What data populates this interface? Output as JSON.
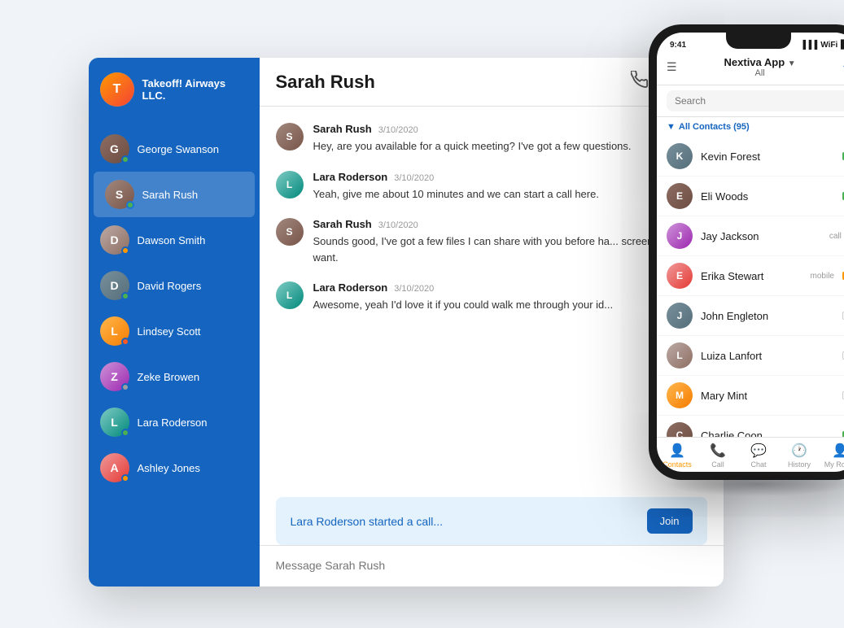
{
  "app": {
    "title": "Takeoff! Airways LLC.",
    "company_name": "Takeoff! Airways LLC."
  },
  "sidebar": {
    "contacts": [
      {
        "name": "George Swanson",
        "status": "active",
        "face": "face-1"
      },
      {
        "name": "Sarah Rush",
        "status": "active",
        "active": true,
        "face": "face-2"
      },
      {
        "name": "Dawson Smith",
        "status": "away",
        "face": "face-3"
      },
      {
        "name": "David Rogers",
        "status": "active",
        "face": "face-4"
      },
      {
        "name": "Lindsey Scott",
        "status": "orange",
        "face": "face-5"
      },
      {
        "name": "Zeke Browen",
        "status": "gray",
        "face": "face-6"
      },
      {
        "name": "Lara Roderson",
        "status": "active",
        "face": "face-7"
      },
      {
        "name": "Ashley Jones",
        "status": "away",
        "face": "face-8"
      }
    ]
  },
  "chat": {
    "header_name": "Sarah Rush",
    "messages": [
      {
        "sender": "Sarah Rush",
        "time": "3/10/2020",
        "text": "Hey, are you available for a quick meeting? I've got a few questions.",
        "face": "face-2"
      },
      {
        "sender": "Lara Roderson",
        "time": "3/10/2020",
        "text": "Yeah, give me about 10 minutes and we can start a call here.",
        "face": "face-7"
      },
      {
        "sender": "Sarah Rush",
        "time": "3/10/2020",
        "text": "Sounds good, I've got a few files I can share with you before ha... screen if you want.",
        "face": "face-2"
      },
      {
        "sender": "Lara Roderson",
        "time": "3/10/2020",
        "text": "Awesome, yeah I'd love it if you could walk me through your id...",
        "face": "face-7"
      }
    ],
    "call_banner": "Lara Roderson started a call...",
    "join_label": "Join",
    "input_placeholder": "Message Sarah Rush"
  },
  "phone": {
    "time": "9:41",
    "app_name": "Nextiva App",
    "all_label": "All",
    "search_placeholder": "Search",
    "section_label": "All Contacts (95)",
    "contacts": [
      {
        "name": "Kevin Forest",
        "status": "sq-green",
        "tag": "",
        "face": "face-4"
      },
      {
        "name": "Eli Woods",
        "status": "sq-green",
        "tag": "",
        "face": "face-1"
      },
      {
        "name": "Jay Jackson",
        "status": "sq-call",
        "tag": "call",
        "face": "face-6"
      },
      {
        "name": "Erika Stewart",
        "status": "sq-orange",
        "tag": "mobile",
        "face": "face-8"
      },
      {
        "name": "John Engleton",
        "status": "sq-empty",
        "tag": "",
        "face": "face-4"
      },
      {
        "name": "Luiza Lanfort",
        "status": "sq-empty",
        "tag": "",
        "face": "face-3"
      },
      {
        "name": "Mary Mint",
        "status": "sq-empty",
        "tag": "",
        "face": "face-5"
      },
      {
        "name": "Charlie Coon",
        "status": "sq-green",
        "tag": "",
        "face": "face-1"
      }
    ],
    "nav": [
      {
        "icon": "👤",
        "label": "Contacts",
        "active": true
      },
      {
        "icon": "📞",
        "label": "Call",
        "active": false
      },
      {
        "icon": "💬",
        "label": "Chat",
        "active": false
      },
      {
        "icon": "🕐",
        "label": "History",
        "active": false
      },
      {
        "icon": "👤",
        "label": "My Room",
        "active": false
      }
    ]
  }
}
